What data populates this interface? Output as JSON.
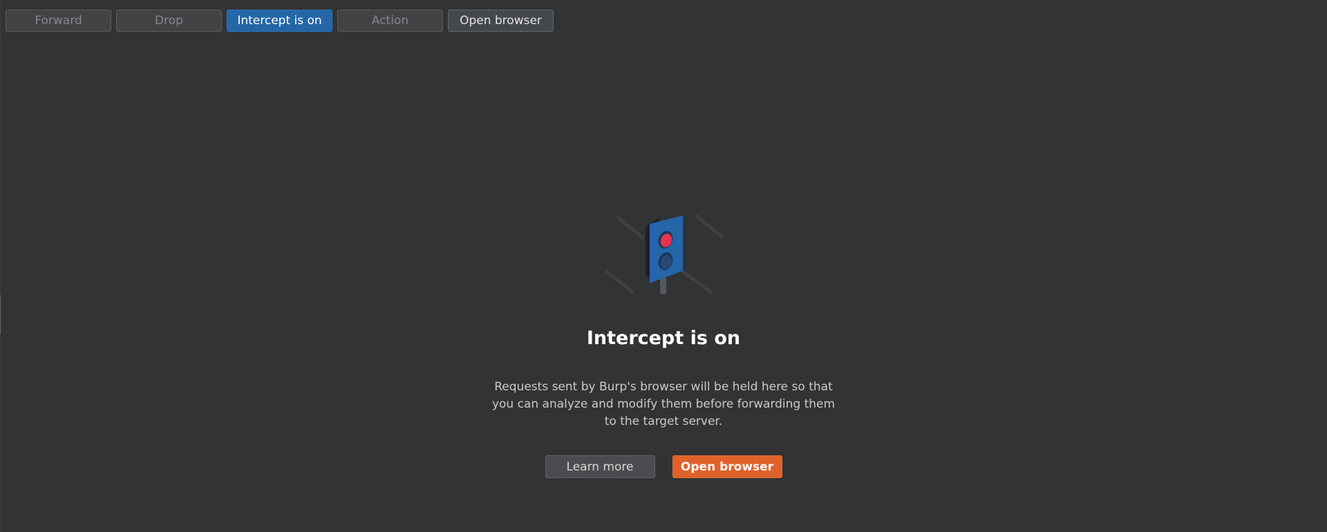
{
  "toolbar": {
    "forward_label": "Forward",
    "drop_label": "Drop",
    "intercept_label": "Intercept is on",
    "action_label": "Action",
    "open_browser_label": "Open browser"
  },
  "empty_state": {
    "title": "Intercept is on",
    "description": "Requests sent by Burp's browser will be held here so that you can analyze and modify them before forwarding them to the target server.",
    "learn_more_label": "Learn more",
    "open_browser_label": "Open browser",
    "illustration_icon": "traffic-light-icon"
  },
  "colors": {
    "background": "#323335",
    "accent_blue": "#2466a8",
    "accent_orange": "#e0622b",
    "light_red": "#e8324c"
  }
}
